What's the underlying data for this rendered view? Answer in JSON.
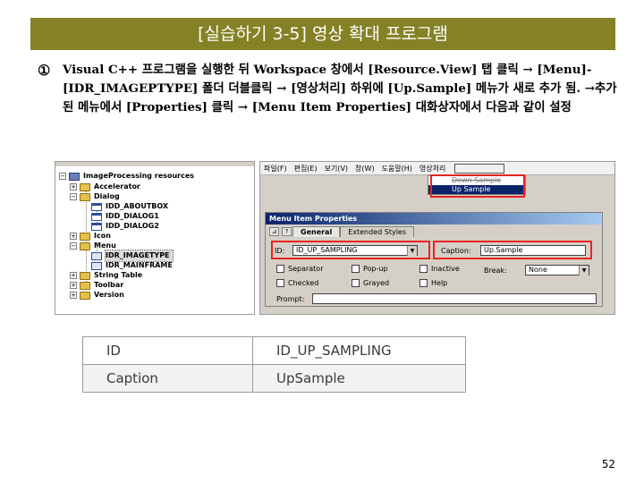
{
  "slide": {
    "title": "[실습하기 3-5] 영상 확대 프로그램",
    "bullet": "①",
    "instruction": "Visual C++ 프로그램을 실행한 뒤 Workspace 창에서 [Resource.View] 탭 클릭 → [Menu]-[IDR_IMAGEPTYPE] 폴더 더블클릭 → [영상처리] 하위에 [Up.Sample] 메뉴가 새로 추가 됨. →추가된 메뉴에서 [Properties] 클릭 → [Menu Item Properties] 대화상자에서 다음과 같이 설정",
    "page_number": "52"
  },
  "resource_tree": {
    "root": "ImageProcessing resources",
    "items": [
      {
        "label": "Accelerator",
        "expander": "+"
      },
      {
        "label": "Dialog",
        "expander": "−"
      },
      {
        "label": "IDD_ABOUTBOX"
      },
      {
        "label": "IDD_DIALOG1"
      },
      {
        "label": "IDD_DIALOG2"
      },
      {
        "label": "Icon",
        "expander": "+"
      },
      {
        "label": "Menu",
        "expander": "−"
      },
      {
        "label": "IDR_IMAGETYPE"
      },
      {
        "label": "IDR_MAINFRAME"
      },
      {
        "label": "String Table",
        "expander": "+"
      },
      {
        "label": "Toolbar",
        "expander": "+"
      },
      {
        "label": "Version",
        "expander": "+"
      }
    ]
  },
  "menu_editor": {
    "menubar": [
      "파일(F)",
      "편집(E)",
      "보기(V)",
      "창(W)",
      "도움말(H)",
      "영상처리"
    ],
    "popup_items": [
      "Down Sample",
      "Up Sample"
    ]
  },
  "properties": {
    "title": "Menu Item Properties",
    "tabs": [
      "General",
      "Extended Styles"
    ],
    "id_label": "ID:",
    "id_value": "ID_UP_SAMPLING",
    "caption_label": "Caption:",
    "caption_value": "Up.Sample",
    "checks_row1": [
      "Separator",
      "Pop-up",
      "Inactive"
    ],
    "checks_row2": [
      "Checked",
      "Grayed",
      "Help"
    ],
    "break_label": "Break:",
    "break_value": "None",
    "prompt_label": "Prompt:"
  },
  "settings_table": {
    "rows": [
      {
        "key": "ID",
        "value": "ID_UP_SAMPLING"
      },
      {
        "key": "Caption",
        "value": "UpSample"
      }
    ]
  },
  "colors": {
    "title_bar": "#848225",
    "highlight_box": "#e8231f",
    "dialog_face": "#d4d0c8",
    "selection": "#0a246a"
  }
}
